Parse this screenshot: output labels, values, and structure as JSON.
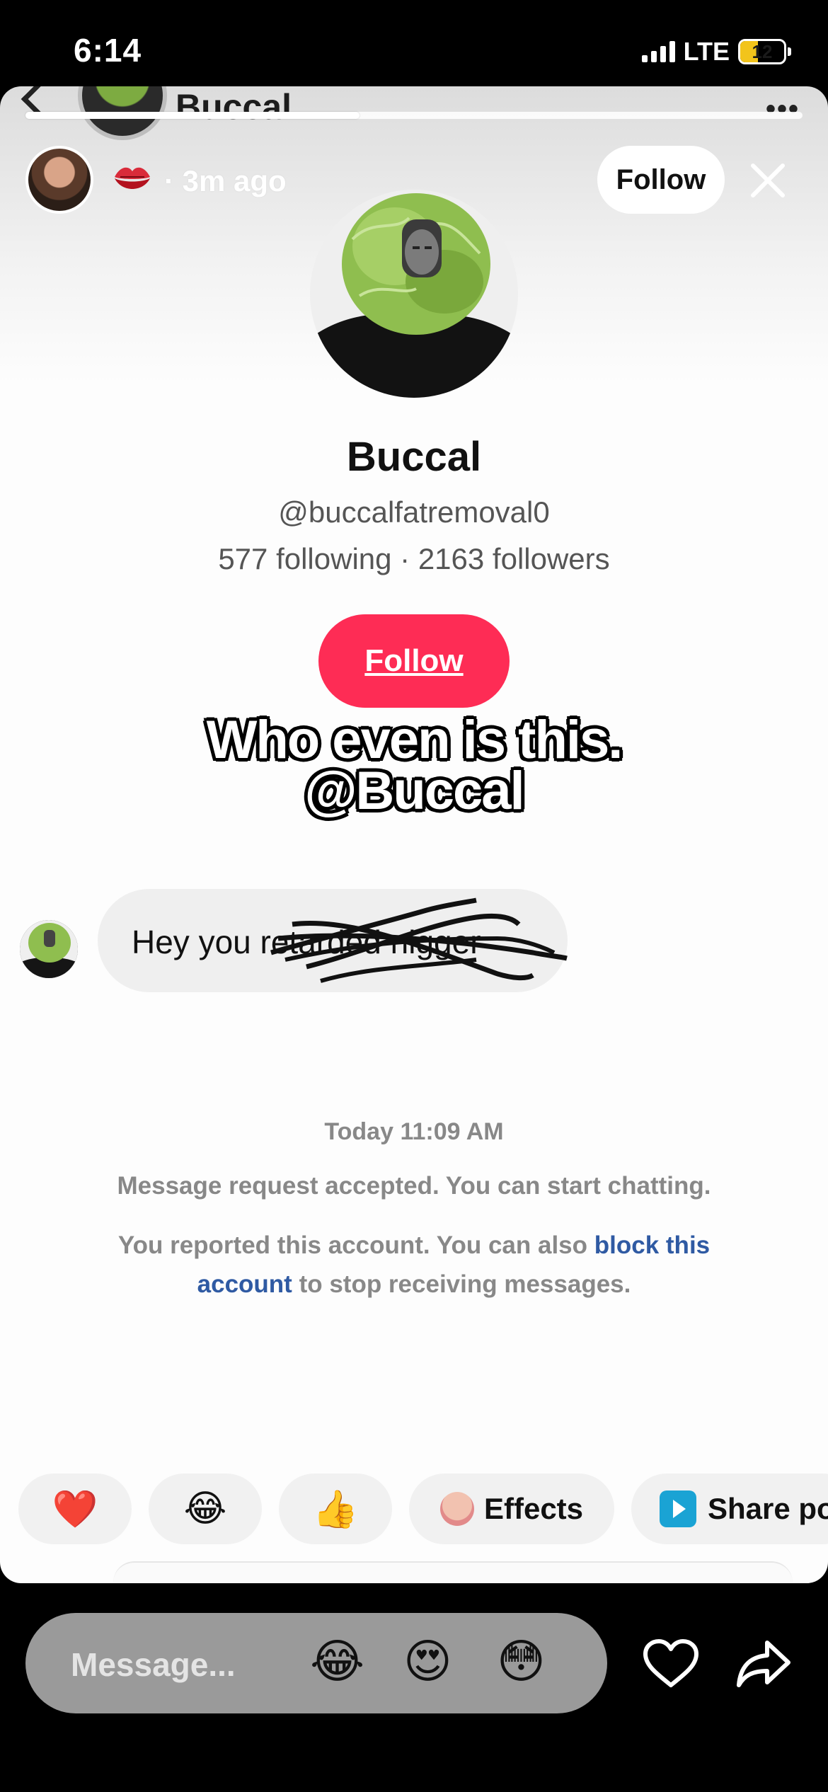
{
  "status_bar": {
    "time": "6:14",
    "network": "LTE",
    "battery_level": "12",
    "battery_fraction": 0.12,
    "battery_color": "#f2c41b"
  },
  "underlying_header": {
    "name": "Buccal"
  },
  "story": {
    "progress_fraction": 0.43,
    "time_ago": "· 3m ago",
    "follow_label": "Follow"
  },
  "profile": {
    "name": "Buccal",
    "handle": "@buccalfatremoval0",
    "stats": "577 following · 2163 followers",
    "follow_label": "Follow",
    "follow_color": "#fe2c55"
  },
  "caption": {
    "line1": "Who even is this.",
    "line2": "@Buccal"
  },
  "message": {
    "text": "Hey you retarded nigger"
  },
  "chat_info": {
    "timestamp": "Today 11:09 AM",
    "accepted": "Message request accepted. You can start chatting.",
    "report_prefix": "You reported this account. You can also ",
    "report_link": "block this account",
    "report_suffix": " to stop receiving messages.",
    "link_color": "#2f5aa3"
  },
  "quick_actions": {
    "heart": "❤️",
    "laugh": "😂",
    "thumbs": "👍",
    "effects_label": "Effects",
    "share_label": "Share po"
  },
  "bottom_bar": {
    "placeholder": "Message...",
    "emoji1": "😂",
    "emoji2": "😍",
    "emoji3": "😳"
  }
}
